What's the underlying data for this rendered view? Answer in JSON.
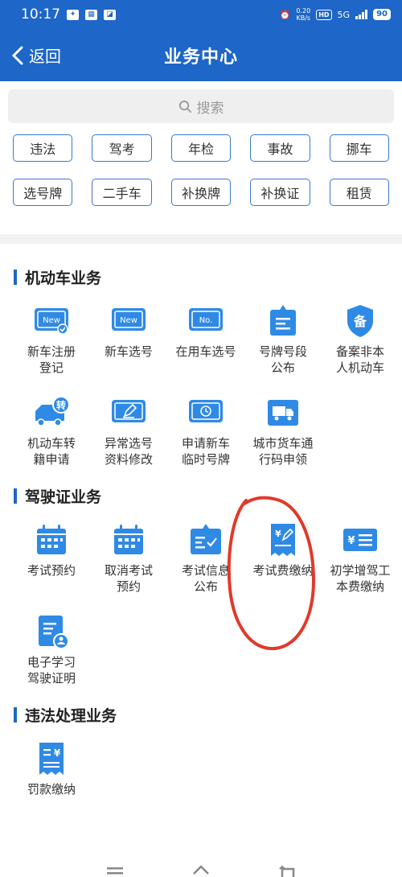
{
  "status": {
    "time": "10:17",
    "net_speed_value": "0.20",
    "net_speed_unit": "KB/s",
    "hd": "HD",
    "network": "5G",
    "battery": "90"
  },
  "nav": {
    "back_label": "返回",
    "title": "业务中心"
  },
  "search": {
    "placeholder": "搜索"
  },
  "quick": [
    "违法",
    "驾考",
    "年检",
    "事故",
    "挪车",
    "选号牌",
    "二手车",
    "补换牌",
    "补换证",
    "租赁"
  ],
  "sections": [
    {
      "title": "机动车业务",
      "items": [
        {
          "l1": "新车注册",
          "l2": "登记",
          "icon": "new-car-register-icon"
        },
        {
          "l1": "新车选号",
          "l2": "",
          "icon": "new-plate-icon"
        },
        {
          "l1": "在用车选号",
          "l2": "",
          "icon": "plate-no-icon"
        },
        {
          "l1": "号牌号段",
          "l2": "公布",
          "icon": "plate-range-icon"
        },
        {
          "l1": "备案非本",
          "l2": "人机动车",
          "icon": "record-shield-icon"
        },
        {
          "l1": "机动车转",
          "l2": "籍申请",
          "icon": "truck-transfer-icon"
        },
        {
          "l1": "异常选号",
          "l2": "资料修改",
          "icon": "edit-plate-icon"
        },
        {
          "l1": "申请新车",
          "l2": "临时号牌",
          "icon": "temp-plate-icon"
        },
        {
          "l1": "城市货车通",
          "l2": "行码申领",
          "icon": "cargo-truck-icon"
        }
      ]
    },
    {
      "title": "驾驶证业务",
      "items": [
        {
          "l1": "考试预约",
          "l2": "",
          "icon": "calendar-icon"
        },
        {
          "l1": "取消考试",
          "l2": "预约",
          "icon": "calendar-cancel-icon"
        },
        {
          "l1": "考试信息",
          "l2": "公布",
          "icon": "exam-info-icon"
        },
        {
          "l1": "考试费缴纳",
          "l2": "",
          "icon": "exam-fee-icon"
        },
        {
          "l1": "初学增驾工",
          "l2": "本费缴纳",
          "icon": "fee-list-icon"
        },
        {
          "l1": "电子学习",
          "l2": "驾驶证明",
          "icon": "e-certificate-icon"
        }
      ]
    },
    {
      "title": "违法处理业务",
      "items": [
        {
          "l1": "罚款缴纳",
          "l2": "",
          "icon": "fine-payment-icon"
        }
      ]
    }
  ],
  "colors": {
    "brand": "#1e66c7",
    "icon_blue": "#2f8ae5",
    "annotation": "#e03a2a"
  }
}
